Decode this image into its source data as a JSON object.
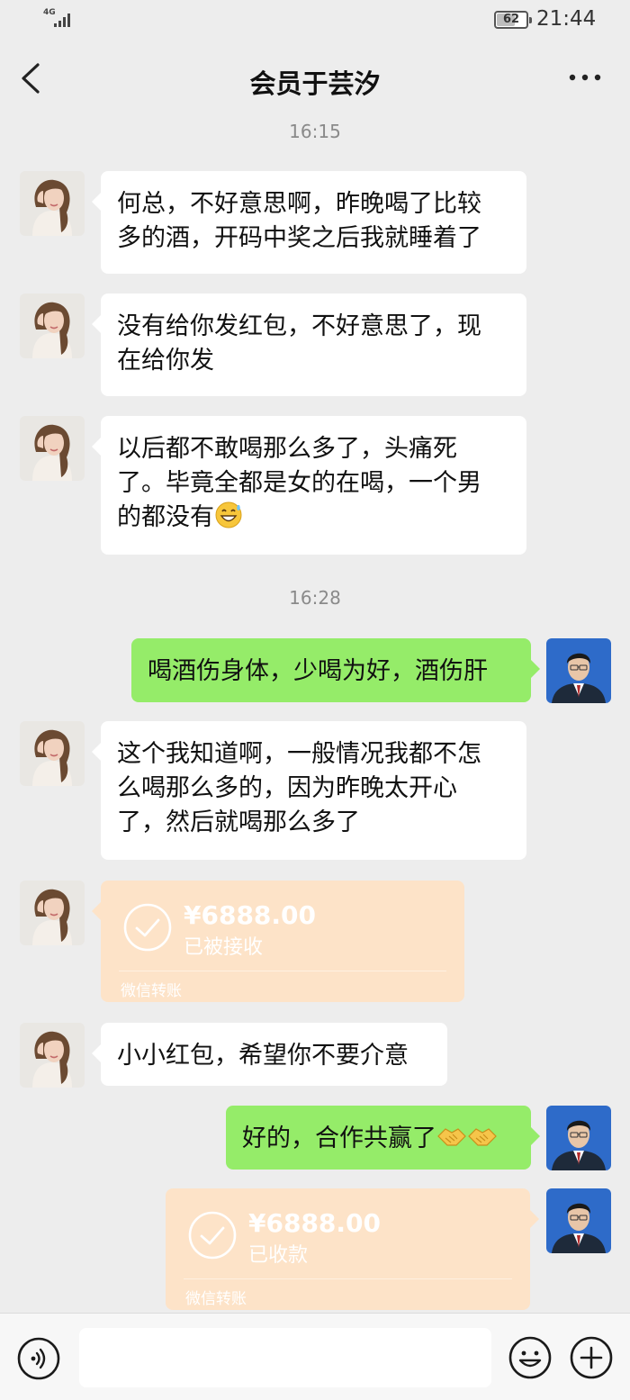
{
  "status_bar": {
    "network": "4G",
    "battery": "62",
    "time": "21:44"
  },
  "header": {
    "title": "会员于芸汐"
  },
  "timestamps": [
    "16:15",
    "16:28"
  ],
  "messages": {
    "m1": {
      "line1": "何总，不好意思啊，昨晚喝了比较",
      "line2": "多的酒，开码中奖之后我就睡着了"
    },
    "m2": {
      "line1": "没有给你发红包，不好意思了，现",
      "line2": "在给你发"
    },
    "m3": {
      "line1": "以后都不敢喝那么多了，头痛死",
      "line2": "了。毕竟全都是女的在喝，一个男",
      "line3": "的都没有"
    },
    "m4": {
      "text": "喝酒伤身体，少喝为好，酒伤肝"
    },
    "m5": {
      "line1": "这个我知道啊，一般情况我都不怎",
      "line2": "么喝那么多的，因为昨晚太开心",
      "line3": "了，然后就喝那么多了"
    },
    "m7": {
      "text": "小小红包，希望你不要介意"
    },
    "m8": {
      "text": "好的，合作共赢了"
    }
  },
  "transfers": {
    "t1": {
      "amount": "¥6888.00",
      "status": "已被接收",
      "footer": "微信转账"
    },
    "t2": {
      "amount": "¥6888.00",
      "status": "已收款",
      "footer": "微信转账"
    }
  },
  "input": {
    "value": ""
  },
  "colors": {
    "background": "#ededed",
    "sent_bubble": "#95ec69",
    "received_bubble": "#ffffff",
    "transfer_bg": "#fde3c8"
  },
  "icons": [
    "back-chevron-icon",
    "more-dots-icon",
    "voice-icon",
    "emoji-icon",
    "plus-icon",
    "grin-sweat-emoji",
    "handshake-emoji",
    "check-circle-icon"
  ]
}
